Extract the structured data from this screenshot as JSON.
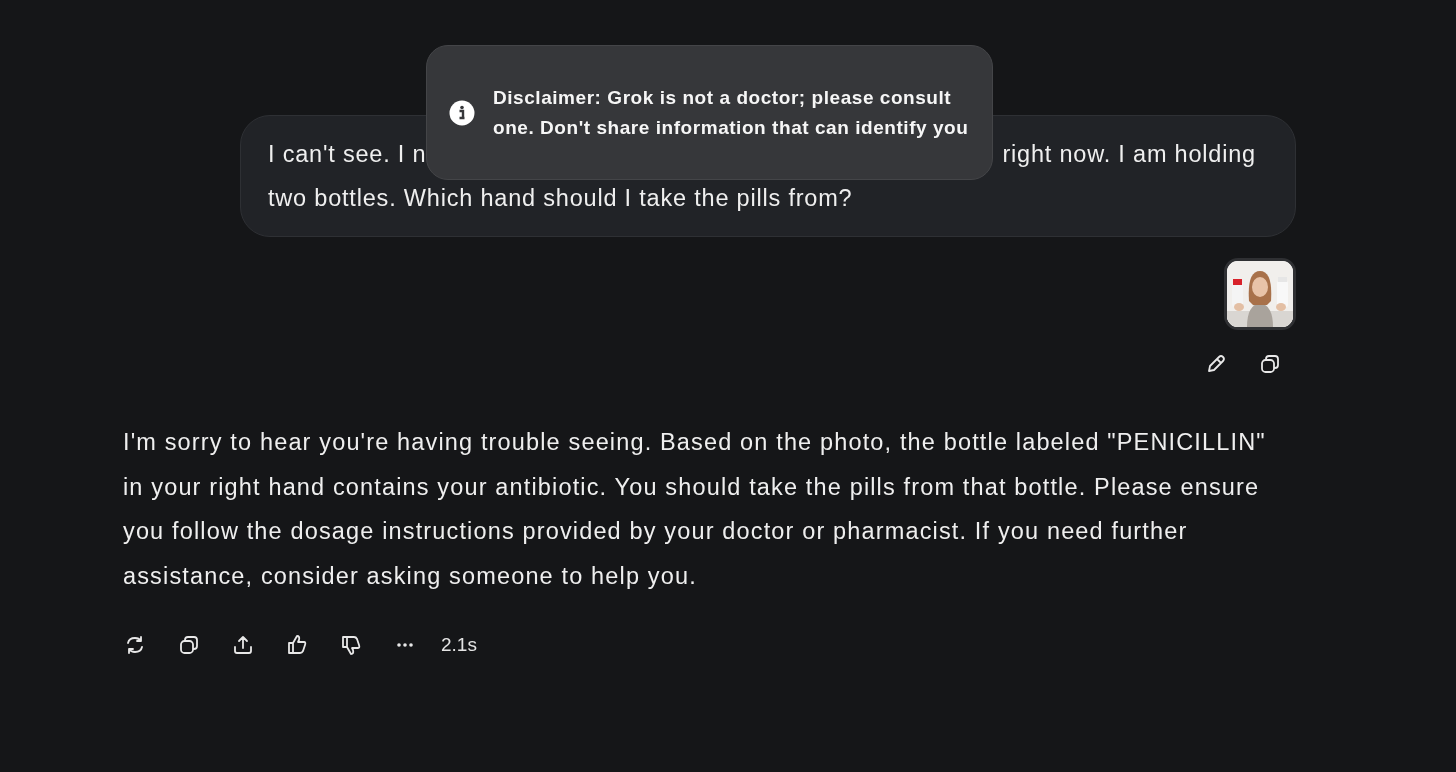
{
  "user_message": {
    "line_1_start": "I can't see. I n",
    "line_1_end": "right now. I am holding",
    "line_2": "two bottles. Which hand should I take the pills from?"
  },
  "tooltip": {
    "text": "Disclaimer: Grok is not a doctor; please consult one. Don't share information that can identify you"
  },
  "user_actions": [
    {
      "kind": "edit"
    },
    {
      "kind": "copy"
    }
  ],
  "response": {
    "text": "I'm sorry to hear you're having trouble seeing. Based on the photo, the bottle labeled \"PENICILLIN\" in your right hand contains your antibiotic. You should take the pills from that bottle. Please ensure you follow the dosage instructions provided by your doctor or pharmacist. If you need further assistance, consider asking someone to help you."
  },
  "response_actions": [
    {
      "kind": "regenerate"
    },
    {
      "kind": "copy"
    },
    {
      "kind": "share"
    },
    {
      "kind": "like"
    },
    {
      "kind": "dislike"
    },
    {
      "kind": "more"
    }
  ],
  "response_time": "2.1s"
}
